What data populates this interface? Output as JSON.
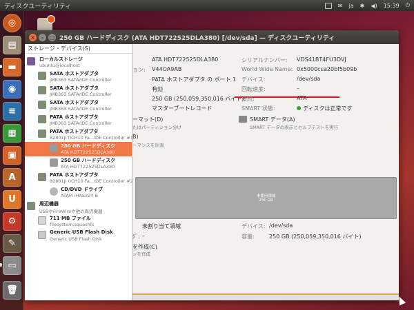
{
  "top_panel": {
    "title": "ディスクユーティリティ",
    "keyboard": "ja",
    "time": "15:39"
  },
  "launcher": {
    "items": [
      "dash-icon",
      "files-icon",
      "folder-icon",
      "firefox-icon",
      "writer-icon",
      "calc-icon",
      "impress-icon",
      "software-center-icon",
      "ubuntu-one-icon",
      "settings-icon",
      "gimp-icon",
      "disk-utility-icon",
      "trash-icon"
    ]
  },
  "window": {
    "title": "250 GB ハードディスク (ATA HDT722525DLA380) [/dev/sda] — ディスクユーティリティ"
  },
  "sidebar": {
    "header": "ストレージ・デバイス(S)",
    "items": [
      {
        "title": "ローカルストレージ",
        "subtitle": "ubuntu@localhost"
      },
      {
        "title": "SATA ホストアダプタ",
        "subtitle": "JMB363 SATA/IDE Controller"
      },
      {
        "title": "SATA ホストアダプタ",
        "subtitle": "JMB363 SATA/IDE Controller"
      },
      {
        "title": "SATA ホストアダプタ",
        "subtitle": "JMB363 SATA/IDE Controller"
      },
      {
        "title": "PATA ホストアダプタ",
        "subtitle": "JMB363 SATA/IDE Controller"
      },
      {
        "title": "PATA ホストアダプタ",
        "subtitle": "82801JI (ICH10 Fa...IDE Controller #1"
      },
      {
        "title": "250 GB ハードディスク",
        "subtitle": "ATA HDT722525DLA380"
      },
      {
        "title": "250 GB ハードディスク",
        "subtitle": "ATA HDT722525DLA380"
      },
      {
        "title": "PATA ホストアダプタ",
        "subtitle": "82801JI (ICH10 Fa...IDE Controller #2"
      },
      {
        "title": "CD/DVD ドライブ",
        "subtitle": "ATAPI iHAS324 B"
      },
      {
        "title": "周辺機器",
        "subtitle": "USBやFireWireや他の周辺機器"
      },
      {
        "title": "711 MB ファイル",
        "subtitle": "filesystem.squashfs"
      },
      {
        "title": "Generic USB Flash Disk",
        "subtitle": "Generic USB Flash Disk"
      }
    ]
  },
  "drive": {
    "model_value": "ATA HDT722525DLA380",
    "firmware_label": "ョン:",
    "firmware_value": "V44OA9AB",
    "location_value": "PATA ホストアダプタ の ポート 1",
    "removable_value": "有効",
    "capacity_value": "250 GB (250,059,350,016 バイト)",
    "partitioning_value": "マスターブートレコード",
    "serial_label": "シリアルナンバー:",
    "serial_value": "VDS41BT4FU3DVJ",
    "wwn_label": "World Wide Name:",
    "wwn_value": "0x5000cca20bf5b09b",
    "device_label": "デバイス:",
    "device_value": "/dev/sda",
    "rotation_label": "回転速度:",
    "rotation_value": "–",
    "connection_label": "接続:",
    "connection_value": "ATA",
    "smart_label": "SMART 状態:",
    "smart_value": "ディスクは正常です"
  },
  "actions": {
    "format_label": "ーマット(D)",
    "format_desc": "たはパーティション分け",
    "smart_data_label": "SMART データ(A)",
    "smart_data_desc": "SMART データの表示とセルフテストを実行",
    "benchmark_label": "B)",
    "benchmark_desc": "ーマンスを計測"
  },
  "volume_bar": {
    "label": "未使用領域",
    "size": "250 GB"
  },
  "volume": {
    "name": "未割り当て領域",
    "type_label": "ﾀﾞ:",
    "type_value": "–",
    "device_label": "デバイス:",
    "device_value": "/dev/sda",
    "capacity_label": "容量:",
    "capacity_value": "250 GB (250,059,350,016 バイト)",
    "create_label": "を作成(C)",
    "create_desc": "ンを作成"
  }
}
